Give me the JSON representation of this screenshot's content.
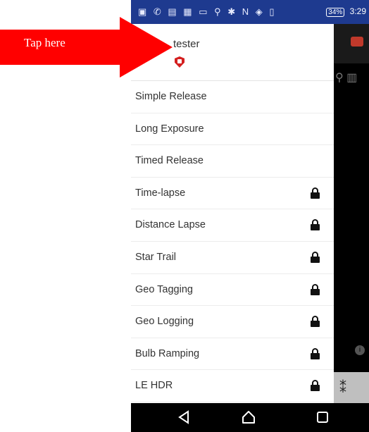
{
  "status_bar": {
    "icons": "▣ ✆ ▤ ▦ ▭ ⚲ ✱ N ◈ ▯",
    "battery": "34%",
    "time": "3:29"
  },
  "drawer": {
    "username": "tester",
    "items": [
      {
        "label": "Simple Release",
        "locked": false
      },
      {
        "label": "Long Exposure",
        "locked": false
      },
      {
        "label": "Timed Release",
        "locked": false
      },
      {
        "label": "Time-lapse",
        "locked": true
      },
      {
        "label": "Distance Lapse",
        "locked": true
      },
      {
        "label": "Star Trail",
        "locked": true
      },
      {
        "label": "Geo Tagging",
        "locked": true
      },
      {
        "label": "Geo Logging",
        "locked": true
      },
      {
        "label": "Bulb Ramping",
        "locked": true
      },
      {
        "label": "LE HDR",
        "locked": true
      }
    ]
  },
  "annotation": {
    "label": "Tap here",
    "color": "#ff0000"
  },
  "colors": {
    "status_bar": "#1e3a8f",
    "shield": "#d42020"
  },
  "nav": {
    "back_icon": "back-triangle-icon",
    "home_icon": "home-icon",
    "recent_icon": "recent-apps-icon"
  }
}
